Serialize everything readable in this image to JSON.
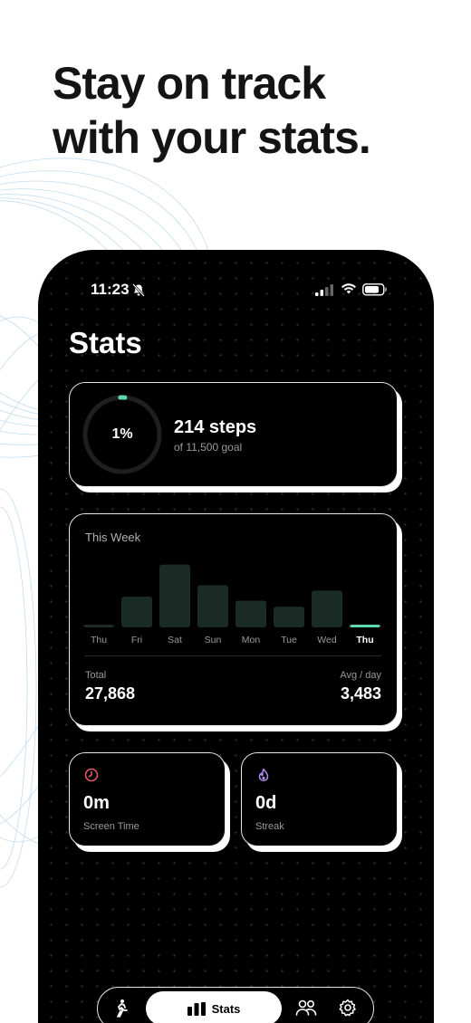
{
  "headline": {
    "line1": "Stay on track",
    "line2": "with your stats."
  },
  "status_bar": {
    "time": "11:23",
    "icons": [
      "bell-slash-icon",
      "signal-icon",
      "wifi-icon",
      "battery-icon"
    ]
  },
  "page": {
    "title": "Stats"
  },
  "steps": {
    "percent_label": "1%",
    "progress": 0.01,
    "count_label": "214 steps",
    "goal_label": "of 11,500 goal"
  },
  "week": {
    "title": "This Week",
    "total_label": "Total",
    "total_value": "27,868",
    "avg_label": "Avg / day",
    "avg_value": "3,483"
  },
  "chart_data": {
    "type": "bar",
    "title": "This Week",
    "categories": [
      "Thu",
      "Fri",
      "Sat",
      "Sun",
      "Mon",
      "Tue",
      "Wed",
      "Thu"
    ],
    "values": [
      214,
      2600,
      5300,
      3550,
      2250,
      1750,
      3100,
      214
    ],
    "highlight_index": 7,
    "ylim": [
      0,
      5500
    ],
    "grid": false,
    "colors": {
      "bar": "#1b2b25",
      "highlight": "#5fd8b0"
    }
  },
  "screen_time": {
    "value": "0m",
    "label": "Screen Time",
    "icon": "clock-icon",
    "icon_color": "#e0566b"
  },
  "streak": {
    "value": "0d",
    "label": "Streak",
    "icon": "flame-icon",
    "icon_color": "#b58cf2"
  },
  "nav": {
    "active_label": "Stats",
    "items": [
      "walk-icon",
      "stats-icon",
      "friends-icon",
      "settings-icon"
    ]
  },
  "colors": {
    "accent": "#5fd8b0",
    "background": "#000000",
    "swirl": "#bcd9ee"
  }
}
